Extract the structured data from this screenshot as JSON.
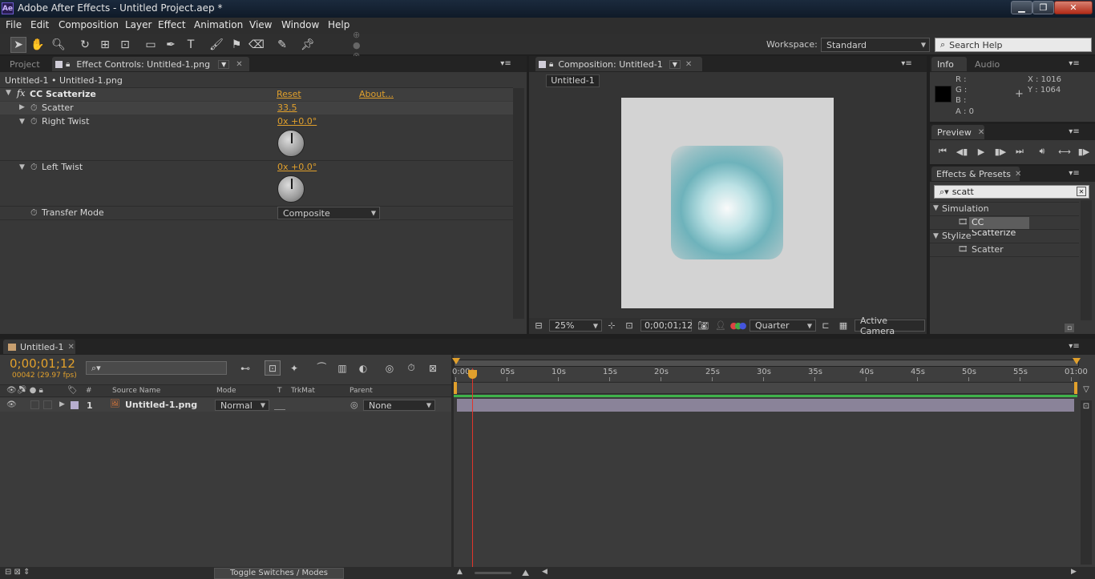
{
  "window": {
    "title": "Adobe After Effects - Untitled Project.aep *",
    "app_badge": "Ae",
    "controls": [
      "minimize-icon",
      "restore-icon",
      "close-icon"
    ]
  },
  "menu": [
    "File",
    "Edit",
    "Composition",
    "Layer",
    "Effect",
    "Animation",
    "View",
    "Window",
    "Help"
  ],
  "toolbar": {
    "tools": [
      "selection-tool-icon",
      "hand-tool-icon",
      "zoom-tool-icon",
      "rotate-tool-icon",
      "orbit-camera-icon",
      "pan-behind-icon",
      "rectangle-tool-icon",
      "pen-tool-icon",
      "type-tool-icon",
      "brush-tool-icon",
      "clone-stamp-icon",
      "eraser-icon",
      "roto-brush-icon",
      "puppet-pin-icon"
    ],
    "workspace_label": "Workspace:",
    "workspace_value": "Standard",
    "search_help_placeholder": "Search Help"
  },
  "effect_controls": {
    "tab_project": "Project",
    "tab_label": "Effect Controls: Untitled-1.png",
    "breadcrumb": "Untitled-1 • Untitled-1.png",
    "effect_fx": "fx",
    "effect_name": "CC Scatterize",
    "reset": "Reset",
    "about": "About...",
    "params": [
      {
        "name": "Scatter",
        "value": "33.5"
      },
      {
        "name": "Right Twist",
        "value": "0x +0.0°"
      },
      {
        "name": "Left Twist",
        "value": "0x +0.0°"
      },
      {
        "name": "Transfer Mode",
        "value": "Composite"
      }
    ]
  },
  "composition": {
    "tab_label": "Composition: Untitled-1",
    "sub_tab": "Untitled-1",
    "zoom": "25%",
    "timecode": "0;00;01;12",
    "resolution": "Quarter",
    "camera": "Active Camera"
  },
  "info": {
    "tab_info": "Info",
    "tab_audio": "Audio",
    "r_label": "R :",
    "g_label": "G :",
    "b_label": "B :",
    "a_label": "A : 0",
    "x_label": "X : 1016",
    "y_label": "Y : 1064"
  },
  "preview": {
    "tab": "Preview"
  },
  "effects_presets": {
    "tab": "Effects & Presets",
    "search_value": "scatt",
    "groups": [
      {
        "name": "Simulation",
        "items": [
          "CC Scatterize"
        ]
      },
      {
        "name": "Stylize",
        "items": [
          "Scatter"
        ]
      }
    ]
  },
  "timeline": {
    "tab": "Untitled-1",
    "timecode": "0;00;01;12",
    "frame_info": "00042 (29.97 fps)",
    "columns": {
      "source": "Source Name",
      "mode": "Mode",
      "t": "T",
      "trkmat": "TrkMat",
      "parent": "Parent",
      "number": "#"
    },
    "layers": [
      {
        "num": "1",
        "name": "Untitled-1.png",
        "mode": "Normal",
        "parent": "None"
      }
    ],
    "ruler_labels": [
      "0:00s",
      "05s",
      "10s",
      "15s",
      "20s",
      "25s",
      "30s",
      "35s",
      "40s",
      "45s",
      "50s",
      "55s",
      "01:00"
    ],
    "toggle_label": "Toggle Switches / Modes"
  },
  "colors": {
    "accent_orange": "#e1a02c",
    "layer_bar": "#8a8399",
    "panel_bg": "#383838",
    "comp_bg": "#d3d3d3",
    "scatter_teal": "#6fb0b8"
  }
}
